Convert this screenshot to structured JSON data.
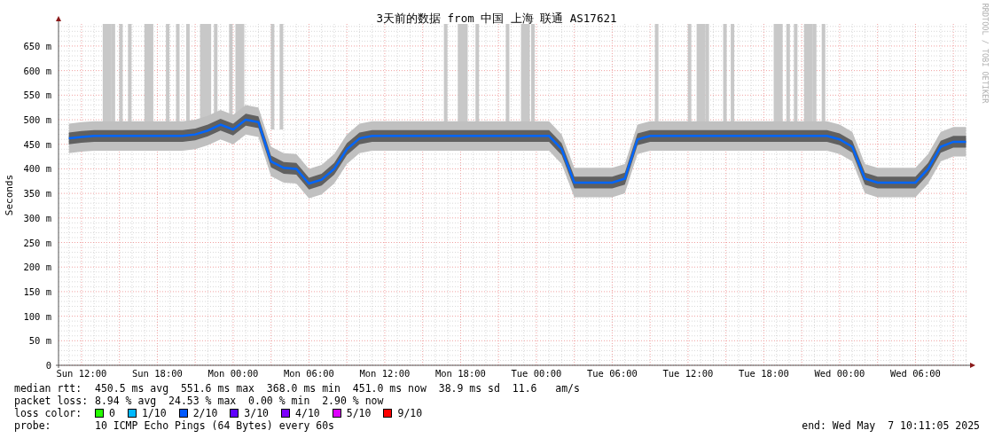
{
  "graph": {
    "chart_data": {
      "type": "line",
      "title": "3天前的数据 from 中国 上海 联通 AS17621",
      "ylabel": "Seconds",
      "categories": [
        null,
        "Sun 12:00",
        null,
        null,
        null,
        null,
        null,
        "Sun 18:00",
        null,
        null,
        null,
        null,
        null,
        "Mon 00:00",
        null,
        null,
        null,
        null,
        null,
        "Mon 06:00",
        null,
        null,
        null,
        null,
        null,
        "Mon 12:00",
        null,
        null,
        null,
        null,
        null,
        "Mon 18:00",
        null,
        null,
        null,
        null,
        null,
        "Tue 00:00",
        null,
        null,
        null,
        null,
        null,
        "Tue 06:00",
        null,
        null,
        null,
        null,
        null,
        "Tue 12:00",
        null,
        null,
        null,
        null,
        null,
        "Tue 18:00",
        null,
        null,
        null,
        null,
        null,
        "Wed 00:00",
        null,
        null,
        null,
        null,
        null,
        "Wed 06:00",
        null,
        null,
        null,
        null
      ],
      "series": [
        {
          "color": "#0066ff",
          "values": [
            462,
            465,
            467,
            467,
            467,
            467,
            467,
            467,
            467,
            467,
            470,
            478,
            490,
            480,
            500,
            495,
            415,
            402,
            400,
            370,
            378,
            400,
            440,
            462,
            467,
            467,
            467,
            467,
            467,
            467,
            467,
            467,
            467,
            467,
            467,
            467,
            467,
            467,
            467,
            440,
            372,
            372,
            372,
            372,
            380,
            460,
            467,
            467,
            467,
            467,
            467,
            467,
            467,
            467,
            467,
            467,
            467,
            467,
            467,
            467,
            467,
            460,
            445,
            380,
            372,
            372,
            372,
            372,
            400,
            445,
            455,
            455
          ]
        }
      ],
      "grid": true,
      "ylim": [
        0,
        695
      ],
      "yticks": [
        {
          "value": 0,
          "label": "0"
        },
        {
          "value": 50,
          "label": "50 m"
        },
        {
          "value": 100,
          "label": "100 m"
        },
        {
          "value": 150,
          "label": "150 m"
        },
        {
          "value": 200,
          "label": "200 m"
        },
        {
          "value": 250,
          "label": "250 m"
        },
        {
          "value": 300,
          "label": "300 m"
        },
        {
          "value": 350,
          "label": "350 m"
        },
        {
          "value": 400,
          "label": "400 m"
        },
        {
          "value": 450,
          "label": "450 m"
        },
        {
          "value": 500,
          "label": "500 m"
        },
        {
          "value": 550,
          "label": "550 m"
        },
        {
          "value": 600,
          "label": "600 m"
        },
        {
          "value": 650,
          "label": "650 m"
        }
      ]
    },
    "credit": "RRDTOOL / TOBI OETIKER"
  },
  "legend": {
    "median_rtt": {
      "label": "median rtt:",
      "text": "450.5 ms avg  551.6 ms max  368.0 ms min  451.0 ms now  38.9 ms sd  11.6   am/s"
    },
    "packet_loss": {
      "label": "packet loss:",
      "text": "8.94 % avg  24.53 % max  0.00 % min  2.90 % now"
    },
    "loss_color": {
      "label": "loss color:",
      "items": [
        {
          "label": "0",
          "color": "#26ff00"
        },
        {
          "label": "1/10",
          "color": "#00b8ff"
        },
        {
          "label": "2/10",
          "color": "#0059ff"
        },
        {
          "label": "3/10",
          "color": "#5e00ff"
        },
        {
          "label": "4/10",
          "color": "#7e00ff"
        },
        {
          "label": "5/10",
          "color": "#dd00ff"
        },
        {
          "label": "9/10",
          "color": "#ff0000"
        }
      ]
    },
    "probe": {
      "label": "probe:",
      "text": "10 ICMP Echo Pings (64 Bytes) every 60s"
    },
    "end": "end: Wed May  7 10:11:05 2025"
  }
}
